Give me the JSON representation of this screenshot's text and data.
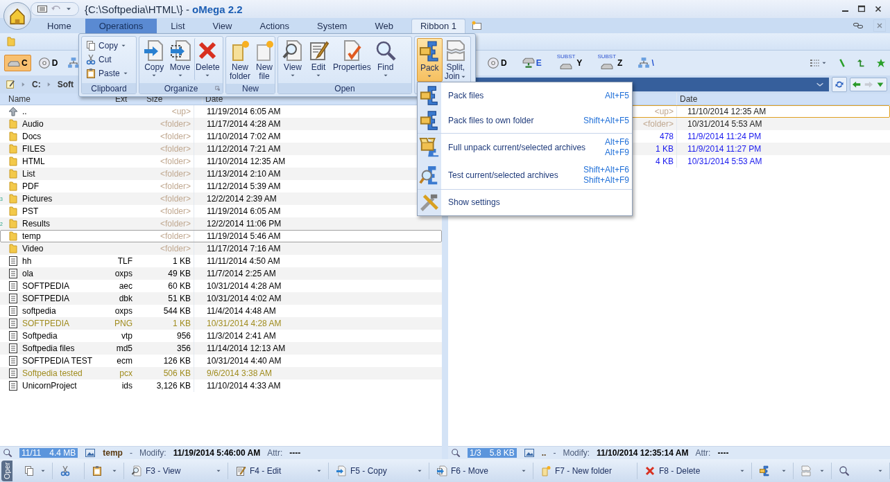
{
  "window": {
    "title_path": "{C:\\Softpedia\\HTML\\} - ",
    "title_app": "oMega 2.2"
  },
  "tabs": [
    {
      "label": "Home",
      "selected": false,
      "kind": "main"
    },
    {
      "label": "Operations",
      "selected": true,
      "kind": "main"
    },
    {
      "label": "List",
      "selected": false,
      "kind": "main"
    },
    {
      "label": "View",
      "selected": false,
      "kind": "main"
    },
    {
      "label": "Actions",
      "selected": false,
      "kind": "main"
    },
    {
      "label": "System",
      "selected": false,
      "kind": "main"
    },
    {
      "label": "Web",
      "selected": false,
      "kind": "main"
    },
    {
      "label": "Ribbon 1",
      "selected": false,
      "kind": "contextual"
    }
  ],
  "ribbon": {
    "groups": [
      {
        "label": "Clipboard",
        "kind": "small",
        "items": [
          {
            "label": "Copy",
            "dropdown": true,
            "pressed": false
          },
          {
            "label": "Cut",
            "dropdown": false,
            "pressed": false
          },
          {
            "label": "Paste",
            "dropdown": true,
            "pressed": false
          }
        ]
      },
      {
        "label": "Organize",
        "kind": "large",
        "launcher": true,
        "items": [
          {
            "label": "Copy",
            "dropdown": true,
            "pressed": false
          },
          {
            "label": "Move",
            "dropdown": true,
            "pressed": false
          },
          {
            "label": "Delete",
            "dropdown": true,
            "pressed": false
          }
        ]
      },
      {
        "label": "New",
        "kind": "large",
        "launcher": false,
        "items": [
          {
            "label": "New folder",
            "dropdown": false,
            "pressed": false
          },
          {
            "label": "New file",
            "dropdown": false,
            "pressed": false
          }
        ]
      },
      {
        "label": "Open",
        "kind": "large",
        "launcher": false,
        "items": [
          {
            "label": "View",
            "dropdown": true,
            "pressed": false
          },
          {
            "label": "Edit",
            "dropdown": true,
            "pressed": false
          },
          {
            "label": "Properties",
            "dropdown": false,
            "pressed": false
          },
          {
            "label": "Find",
            "dropdown": true,
            "pressed": false
          }
        ]
      },
      {
        "kind": "large",
        "launcher": false,
        "items": [
          {
            "label": "Pack",
            "dropdown": true,
            "pressed": true
          },
          {
            "label": "Split, Join",
            "dropdown": true,
            "pressed": false
          }
        ]
      }
    ]
  },
  "panes": [
    {
      "drives": [
        {
          "kind": "local",
          "letter": "C",
          "selected": true
        },
        {
          "kind": "cd",
          "letter": "D",
          "selected": false
        },
        {
          "kind": "network",
          "selected": false
        }
      ],
      "path": [
        "C:",
        "Soft"
      ],
      "columns": [
        "Name",
        "Ext",
        "Size",
        "Date"
      ],
      "rows": [
        {
          "kind": "up",
          "name": "..",
          "size": "<up>",
          "date": "11/19/2014 6:05 AM",
          "color": "#000000",
          "focused": false
        },
        {
          "kind": "folder",
          "name": "Audio",
          "size": "<folder>",
          "date": "11/17/2014 4:28 AM",
          "color": "#000000",
          "focused": false
        },
        {
          "kind": "folder",
          "name": "Docs",
          "size": "<folder>",
          "date": "11/10/2014 7:02 AM",
          "color": "#000000",
          "focused": false
        },
        {
          "kind": "folder",
          "name": "FILES",
          "size": "<folder>",
          "date": "11/12/2014 7:21 AM",
          "color": "#000000",
          "focused": false
        },
        {
          "kind": "folder",
          "name": "HTML",
          "size": "<folder>",
          "date": "11/10/2014 12:35 AM",
          "color": "#000000",
          "focused": false
        },
        {
          "kind": "folder",
          "name": "List",
          "size": "<folder>",
          "date": "11/13/2014 2:10 AM",
          "color": "#000000",
          "focused": false
        },
        {
          "kind": "folder",
          "name": "PDF",
          "size": "<folder>",
          "date": "11/12/2014 5:39 AM",
          "color": "#000000",
          "focused": false
        },
        {
          "kind": "folder",
          "name": "Pictures",
          "size": "<folder>",
          "date": "12/2/2014 2:39 AM",
          "color": "#000000",
          "focused": false,
          "marker": "3"
        },
        {
          "kind": "folder",
          "name": "PST",
          "size": "<folder>",
          "date": "11/19/2014 6:05 AM",
          "color": "#000000",
          "focused": false
        },
        {
          "kind": "folder",
          "name": "Results",
          "size": "<folder>",
          "date": "12/2/2014 11:06 PM",
          "color": "#000000",
          "focused": false,
          "marker": "2"
        },
        {
          "kind": "folder",
          "name": "temp",
          "size": "<folder>",
          "date": "11/19/2014 5:46 AM",
          "color": "#000000",
          "focused": true
        },
        {
          "kind": "folder",
          "name": "Video",
          "size": "<folder>",
          "date": "11/17/2014 7:16 AM",
          "color": "#000000",
          "focused": false
        },
        {
          "kind": "file",
          "name": "hh",
          "ext": "TLF",
          "size": "1 KB",
          "date": "11/11/2014 4:50 AM",
          "color": "#000000",
          "focused": false
        },
        {
          "kind": "file",
          "name": "ola",
          "ext": "oxps",
          "size": "49 KB",
          "date": "11/7/2014 2:25 AM",
          "color": "#000000",
          "focused": false
        },
        {
          "kind": "file",
          "name": "SOFTPEDIA",
          "ext": "aec",
          "size": "60 KB",
          "date": "10/31/2014 4:28 AM",
          "color": "#000000",
          "focused": false
        },
        {
          "kind": "file",
          "name": "SOFTPEDIA",
          "ext": "dbk",
          "size": "51 KB",
          "date": "10/31/2014 4:02 AM",
          "color": "#000000",
          "focused": false
        },
        {
          "kind": "file",
          "name": "softpedia",
          "ext": "oxps",
          "size": "544 KB",
          "date": "11/4/2014 4:48 AM",
          "color": "#000000",
          "focused": false
        },
        {
          "kind": "file",
          "name": "SOFTPEDIA",
          "ext": "PNG",
          "size": "1 KB",
          "date": "10/31/2014 4:28 AM",
          "color": "#a08c1e",
          "focused": false
        },
        {
          "kind": "file",
          "name": "Softpedia",
          "ext": "vtp",
          "size": "956",
          "date": "11/3/2014 2:41 AM",
          "color": "#000000",
          "focused": false
        },
        {
          "kind": "file",
          "name": "Softpedia files",
          "ext": "md5",
          "size": "356",
          "date": "11/14/2014 12:13 AM",
          "color": "#000000",
          "focused": false
        },
        {
          "kind": "file",
          "name": "SOFTPEDIA TEST",
          "ext": "ecm",
          "size": "126 KB",
          "date": "10/31/2014 4:40 AM",
          "color": "#000000",
          "focused": false
        },
        {
          "kind": "file",
          "name": "Softpedia tested",
          "ext": "pcx",
          "size": "506 KB",
          "date": "9/6/2014 3:38 AM",
          "color": "#a08c1e",
          "focused": false
        },
        {
          "kind": "file",
          "name": "UnicornProject",
          "ext": "ids",
          "size": "3,126 KB",
          "date": "11/10/2014 4:33 AM",
          "color": "#000000",
          "focused": false
        }
      ],
      "status": {
        "count": "11/11",
        "size": "4.4 MB",
        "name": "temp",
        "dash": "-",
        "modify_label": "Modify:",
        "modify": "11/19/2014 5:46:00 AM",
        "attr_label": "Attr:",
        "attr": "----"
      }
    },
    {
      "drives": [
        {
          "kind": "cd",
          "letter": "D",
          "selected": false
        },
        {
          "kind": "netdrive",
          "letter": "E",
          "selected": false
        },
        {
          "kind": "subst",
          "letter": "Y",
          "badge": "SUBST",
          "selected": false
        },
        {
          "kind": "subst",
          "letter": "Z",
          "badge": "SUBST",
          "selected": false
        },
        {
          "kind": "network",
          "letter": "\\",
          "selected": false
        }
      ],
      "columns": [
        "Date"
      ],
      "rows": [
        {
          "kind": "up",
          "size": "<up>",
          "date": "11/10/2014 12:35 AM",
          "color": "#222222",
          "focused": true
        },
        {
          "kind": "folder",
          "size": "<folder>",
          "date": "10/31/2014 5:53 AM",
          "color": "#222222",
          "focused": false
        },
        {
          "kind": "file",
          "size": "478",
          "date": "11/9/2014 11:24 PM",
          "color": "#1a1aee",
          "focused": false
        },
        {
          "kind": "file",
          "size": "1 KB",
          "date": "11/9/2014 11:27 PM",
          "color": "#1a1aee",
          "focused": false
        },
        {
          "kind": "file",
          "size": "4 KB",
          "date": "10/31/2014 5:53 AM",
          "color": "#1a1aee",
          "focused": false
        }
      ],
      "status": {
        "count": "1/3",
        "size": "5.8 KB",
        "name": "..",
        "dash": "-",
        "modify_label": "Modify:",
        "modify": "11/10/2014 12:35:14 AM",
        "attr_label": "Attr:",
        "attr": "----"
      }
    }
  ],
  "menu": {
    "items": [
      {
        "label": "Pack files",
        "shortcuts": [
          "Alt+F5"
        ],
        "separator_before": false
      },
      {
        "label": "Pack files to own folder",
        "shortcuts": [
          "Shift+Alt+F5"
        ],
        "separator_before": false
      },
      {
        "label": "Full unpack current/selected archives",
        "shortcuts": [
          "Alt+F6",
          "Alt+F9"
        ],
        "separator_before": true
      },
      {
        "label": "Test current/selected archives",
        "shortcuts": [
          "Shift+Alt+F6",
          "Shift+Alt+F9"
        ],
        "separator_before": false
      },
      {
        "label": "Show settings",
        "separator_before": true
      }
    ]
  },
  "toolbar": {
    "section_label": "Oper",
    "buttons": [
      {
        "dropdown": true
      },
      {
        "dropdown": false
      },
      {
        "dropdown": true
      },
      {
        "label": "F3 - View",
        "dropdown": true
      },
      {
        "label": "F4 - Edit",
        "dropdown": true
      },
      {
        "label": "F5 - Copy",
        "dropdown": true
      },
      {
        "label": "F6 - Move",
        "dropdown": true
      },
      {
        "label": "F7 - New folder",
        "dropdown": false
      },
      {
        "label": "F8 - Delete",
        "dropdown": true
      },
      {
        "dropdown": true
      },
      {
        "dropdown": true
      },
      {
        "dropdown": true
      }
    ]
  }
}
